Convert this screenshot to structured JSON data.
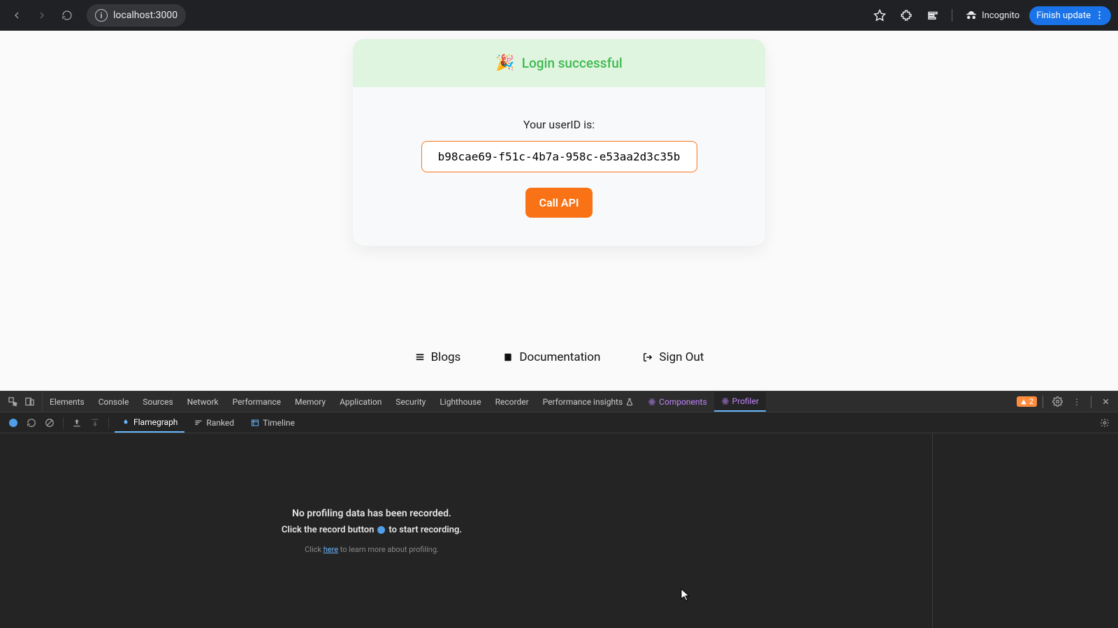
{
  "browser": {
    "url": "localhost:3000",
    "incognito_label": "Incognito",
    "finish_update_label": "Finish update"
  },
  "card": {
    "banner_emoji": "🎉",
    "banner_text": "Login successful",
    "userid_label": "Your userID is:",
    "userid_value": "b98cae69-f51c-4b7a-958c-e53aa2d3c35b",
    "call_api_label": "Call API"
  },
  "footer": {
    "blogs": "Blogs",
    "docs": "Documentation",
    "signout": "Sign Out"
  },
  "devtools": {
    "tabs": {
      "elements": "Elements",
      "console": "Console",
      "sources": "Sources",
      "network": "Network",
      "performance": "Performance",
      "memory": "Memory",
      "application": "Application",
      "security": "Security",
      "lighthouse": "Lighthouse",
      "recorder": "Recorder",
      "perf_insights": "Performance insights",
      "components": "Components",
      "profiler": "Profiler"
    },
    "warning_count": "2",
    "views": {
      "flamegraph": "Flamegraph",
      "ranked": "Ranked",
      "timeline": "Timeline"
    },
    "empty": {
      "title": "No profiling data has been recorded.",
      "prefix": "Click the record button",
      "suffix": "to start recording.",
      "hint_prefix": "Click ",
      "hint_link": "here",
      "hint_suffix": " to learn more about profiling."
    }
  }
}
